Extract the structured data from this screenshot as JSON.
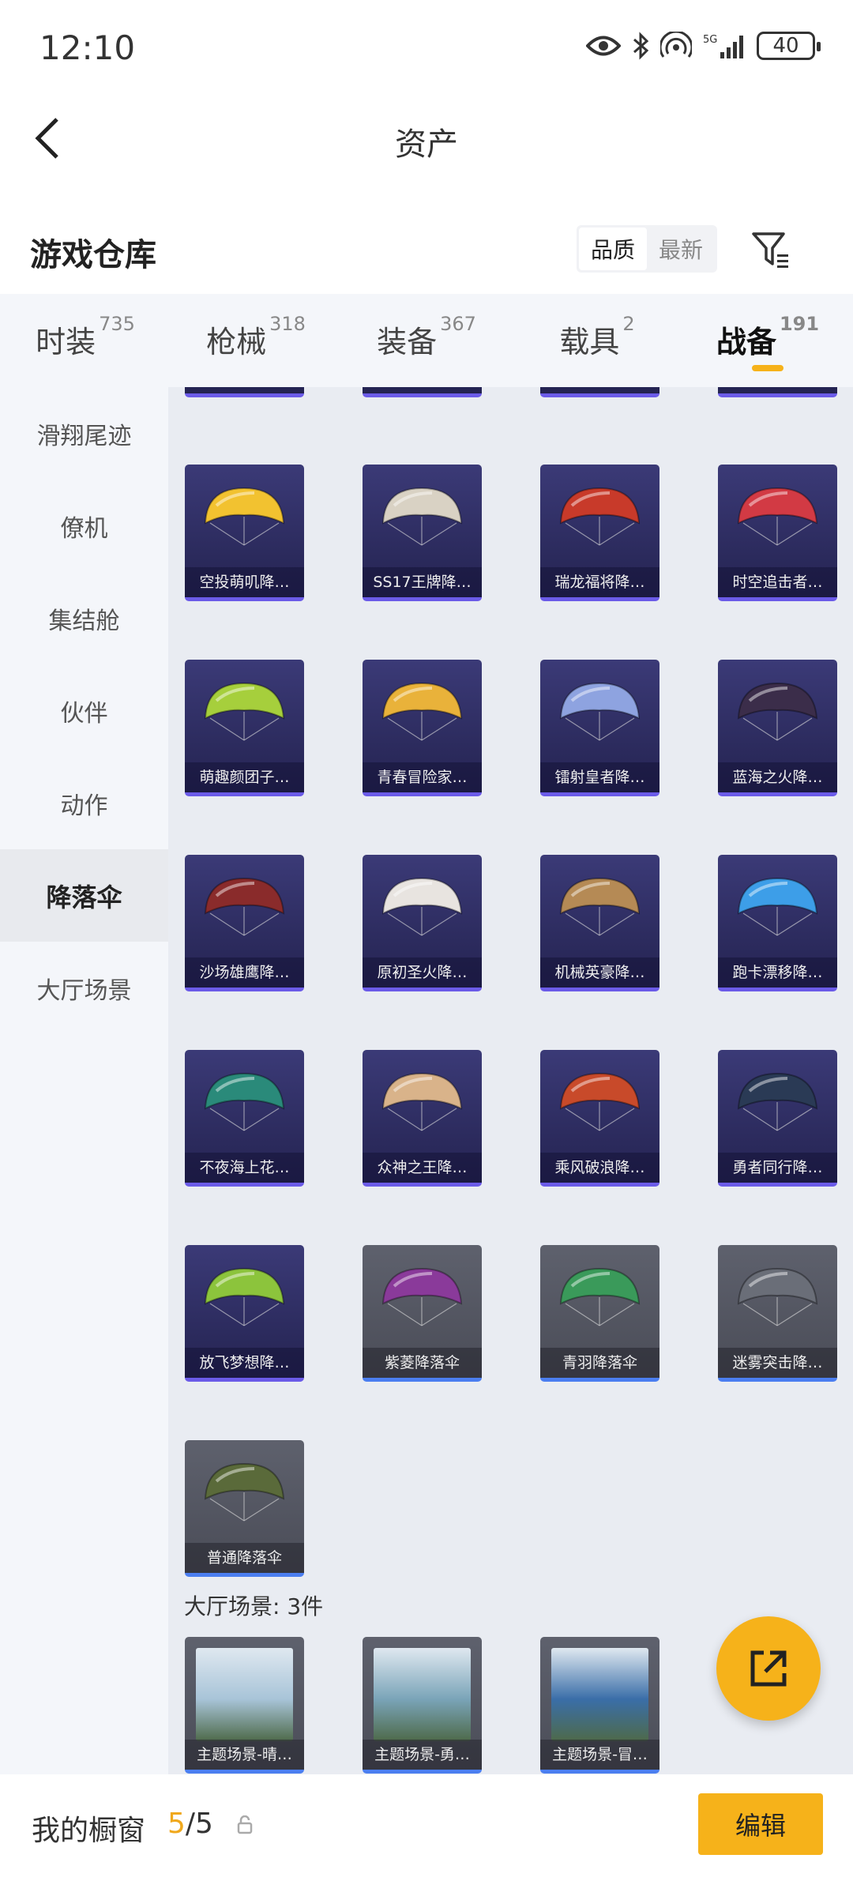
{
  "status": {
    "time": "12:10",
    "battery": "40"
  },
  "header": {
    "title": "资产"
  },
  "warehouse": {
    "title": "游戏仓库",
    "sort_options": [
      "品质",
      "最新"
    ]
  },
  "tabs": [
    {
      "label": "时装",
      "count": "735"
    },
    {
      "label": "枪械",
      "count": "318"
    },
    {
      "label": "装备",
      "count": "367"
    },
    {
      "label": "载具",
      "count": "2"
    },
    {
      "label": "战备",
      "count": "191"
    }
  ],
  "sidebar": {
    "items": [
      "滑翔尾迹",
      "僚机",
      "集结舱",
      "伙伴",
      "动作",
      "降落伞",
      "大厅场景"
    ],
    "active": "降落伞"
  },
  "parachutes": [
    {
      "name": "空投萌叽降…",
      "color": "#f2c230"
    },
    {
      "name": "SS17王牌降…",
      "color": "#d9d2c4"
    },
    {
      "name": "瑞龙福将降…",
      "color": "#c83a2a"
    },
    {
      "name": "时空追击者…",
      "color": "#d23a44"
    },
    {
      "name": "萌趣颜团子…",
      "color": "#a6cf3c"
    },
    {
      "name": "青春冒险家…",
      "color": "#e9b23a"
    },
    {
      "name": "镭射皇者降…",
      "color": "#8ea3e0"
    },
    {
      "name": "蓝海之火降…",
      "color": "#3b2d4a"
    },
    {
      "name": "沙场雄鹰降…",
      "color": "#8a2b2b"
    },
    {
      "name": "原初圣火降…",
      "color": "#e8e4e0"
    },
    {
      "name": "机械英豪降…",
      "color": "#b58a55"
    },
    {
      "name": "跑卡漂移降…",
      "color": "#3d9ee8"
    },
    {
      "name": "不夜海上花…",
      "color": "#2a8a7a"
    },
    {
      "name": "众神之王降…",
      "color": "#d9b38a"
    },
    {
      "name": "乘风破浪降…",
      "color": "#c84a2a"
    },
    {
      "name": "勇者同行降…",
      "color": "#2a3a55"
    },
    {
      "name": "放飞梦想降…",
      "color": "#8cc43c"
    },
    {
      "name": "紫菱降落伞",
      "color": "#8a3a9a"
    },
    {
      "name": "青羽降落伞",
      "color": "#3a9a5a"
    },
    {
      "name": "迷雾突击降…",
      "color": "#6a6e78"
    },
    {
      "name": "普通降落伞",
      "color": "#5a6a3a"
    }
  ],
  "scenes_section": {
    "label": "大厅场景: 3件"
  },
  "scenes": [
    {
      "name": "主题场景-晴…",
      "color": "#a8c4d8"
    },
    {
      "name": "主题场景-勇…",
      "color": "#7aa4b8"
    },
    {
      "name": "主题场景-冒…",
      "color": "#3a6ea8"
    }
  ],
  "bottom": {
    "showcase_label": "我的橱窗",
    "current": "5",
    "total": "/5",
    "edit_label": "编辑"
  }
}
